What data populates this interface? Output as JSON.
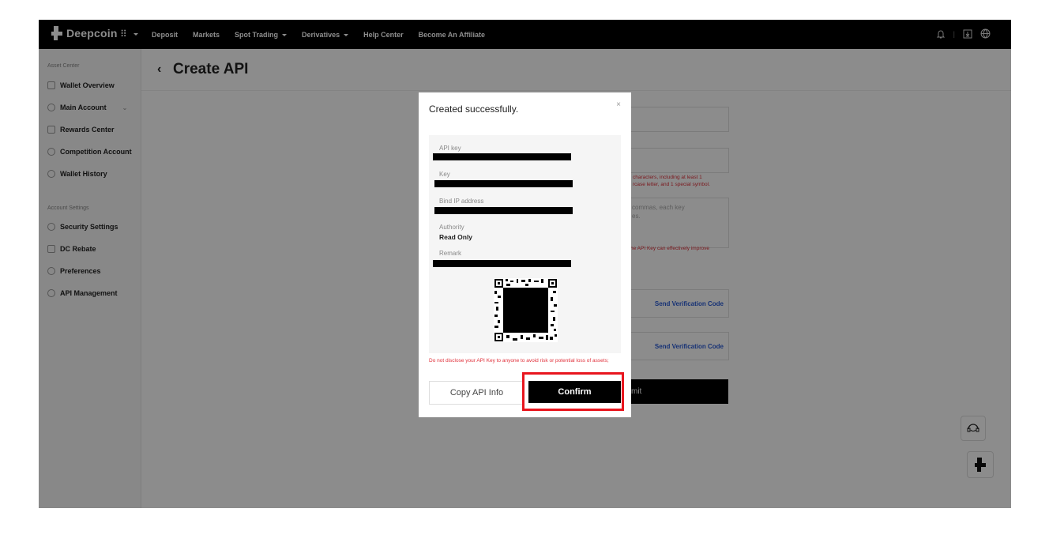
{
  "brand": {
    "name": "Deepcoin"
  },
  "nav": {
    "items": [
      {
        "label": "Deposit",
        "dropdown": false
      },
      {
        "label": "Markets",
        "dropdown": false
      },
      {
        "label": "Spot Trading",
        "dropdown": true
      },
      {
        "label": "Derivatives",
        "dropdown": true
      },
      {
        "label": "Help Center",
        "dropdown": false
      },
      {
        "label": "Become An Affiliate",
        "dropdown": false
      }
    ],
    "icons": [
      "bell-icon",
      "download-icon",
      "globe-icon"
    ]
  },
  "sidebar": {
    "asset_section": "Asset Center",
    "asset_items": [
      {
        "label": "Wallet Overview",
        "icon": "wallet-icon"
      },
      {
        "label": "Main Account",
        "icon": "account-icon"
      },
      {
        "label": "Rewards Center",
        "icon": "gift-icon"
      },
      {
        "label": "Competition Account",
        "icon": "trophy-icon"
      },
      {
        "label": "Wallet History",
        "icon": "clock-icon"
      }
    ],
    "settings_section": "Account Settings",
    "settings_items": [
      {
        "label": "Security Settings",
        "icon": "shield-icon"
      },
      {
        "label": "DC Rebate",
        "icon": "rebate-icon"
      },
      {
        "label": "Preferences",
        "icon": "preferences-icon"
      },
      {
        "label": "API Management",
        "icon": "api-icon"
      }
    ]
  },
  "page": {
    "title": "Create API"
  },
  "form": {
    "password_hint_line1": "characters, including at least 1",
    "password_hint_line2": "rcase letter, and 1 special symbol.",
    "ip_placeholder_line1": "commas, each key",
    "ip_placeholder_line2": "es.",
    "ip_hint": "he API Key can effectively improve",
    "send_code_1": "Send Verification Code",
    "send_code_2": "Send Verification Code",
    "submit_label": "mit"
  },
  "modal": {
    "title": "Created successfully.",
    "close_symbol": "×",
    "fields": {
      "api_key_label": "API key",
      "key_label": "Key",
      "bind_ip_label": "Bind IP address",
      "authority_label": "Authority",
      "authority_value": "Read Only",
      "remark_label": "Remark"
    },
    "warning": "Do not disclose your API Key to anyone to avoid risk or potential loss of assets;",
    "copy_label": "Copy API Info",
    "confirm_label": "Confirm"
  },
  "colors": {
    "accent": "#000000",
    "warning": "#e0303a",
    "link": "#2a5cd6",
    "highlight": "#e8161e"
  }
}
